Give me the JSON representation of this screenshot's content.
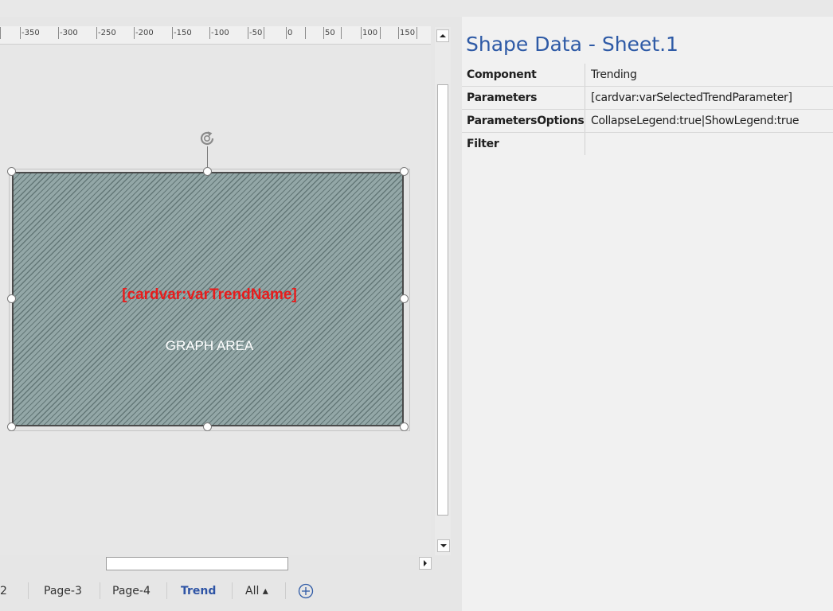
{
  "ruler": {
    "labels": [
      "-350",
      "-300",
      "-250",
      "-200",
      "-150",
      "-100",
      "-50",
      "0",
      "50",
      "100",
      "150"
    ]
  },
  "canvas": {
    "trend_name": "[cardvar:varTrendName]",
    "graph_label": "GRAPH AREA",
    "shape_fill": "#93a7a7",
    "trend_name_color": "#e81c1c"
  },
  "tabs": {
    "items": [
      "2",
      "Page-3",
      "Page-4",
      "Trend",
      "All ▴"
    ],
    "active": "Trend",
    "add_icon": "add-page-icon"
  },
  "shape_data": {
    "title": "Shape Data - Sheet.1",
    "rows": [
      {
        "label": "Component",
        "value": "Trending"
      },
      {
        "label": "Parameters",
        "value": "[cardvar:varSelectedTrendParameter]"
      },
      {
        "label": "ParametersOptions",
        "value": "CollapseLegend:true|ShowLegend:true"
      },
      {
        "label": "Filter",
        "value": ""
      }
    ]
  },
  "colors": {
    "accent": "#2e5aa6",
    "panel_bg": "#f1f1f1",
    "canvas_bg": "#e7e7e7"
  }
}
